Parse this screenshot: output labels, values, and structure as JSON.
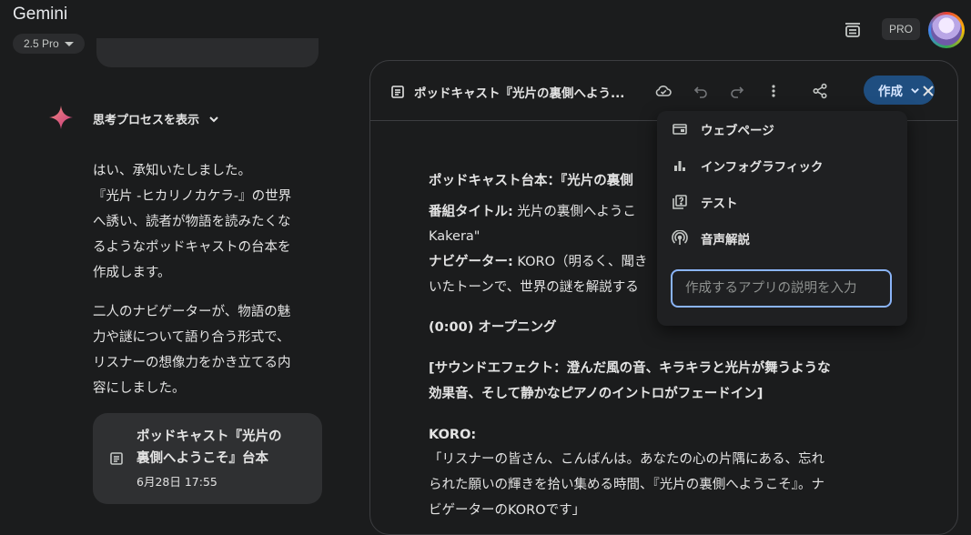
{
  "app": {
    "title": "Gemini",
    "model": "2.5 Pro",
    "plan_badge": "PRO"
  },
  "thinking": {
    "label": "思考プロセスを表示"
  },
  "response": {
    "paragraph1": [
      "はい、承知いたしました。",
      "『光片 -ヒカリノカケラ-』の世界",
      "へ誘い、読者が物語を読みたくな",
      "るようなポッドキャストの台本を",
      "作成します。"
    ],
    "paragraph2": [
      "二人のナビゲーターが、物語の魅",
      "力や謎について語り合う形式で、",
      "リスナーの想像力をかき立てる内",
      "容にしました。"
    ]
  },
  "card": {
    "title_line1": "ポッドキャスト『光片の",
    "title_line2": "裏側へようこそ』台本",
    "date": "6月28日 17:55"
  },
  "canvas": {
    "title": "ポッドキャスト『光片の裏側へよう...",
    "create_label": "作成",
    "doc": {
      "heading": "ポッドキャスト台本：『光片の裏側",
      "program_label": "番組タイトル:",
      "program_value": " 光片の裏側へようこ",
      "program_line2": "Kakera\"",
      "navigator_label": "ナビゲーター:",
      "navigator_value": " KORO（明るく、聞き",
      "navigator_line2": "いたトーンで、世界の謎を解説する",
      "opening": "(0:00) オープニング",
      "sfx_line1": "[サウンドエフェクト：澄んだ風の音、キラキラと光片が舞うような",
      "sfx_line2": "効果音、そして静かなピアノのイントロがフェードイン]",
      "speaker": "KORO:",
      "quote_line1": "「リスナーの皆さん、こんばんは。あなたの心の片隅にある、忘れ",
      "quote_line2": "られた願いの輝きを拾い集める時間、『光片の裏側へようこそ』。ナ",
      "quote_line3": "ビゲーターのKOROです」"
    }
  },
  "menu": {
    "items": [
      {
        "label": "ウェブページ",
        "icon": "webpage-icon"
      },
      {
        "label": "インフォグラフィック",
        "icon": "bar-chart-icon"
      },
      {
        "label": "テスト",
        "icon": "quiz-icon"
      },
      {
        "label": "音声解説",
        "icon": "podcast-icon"
      }
    ],
    "input_placeholder": "作成するアプリの説明を入力"
  },
  "colors": {
    "accent": "#1f4e80",
    "input_border": "#8ab4f8",
    "background": "#1b1c1d"
  }
}
